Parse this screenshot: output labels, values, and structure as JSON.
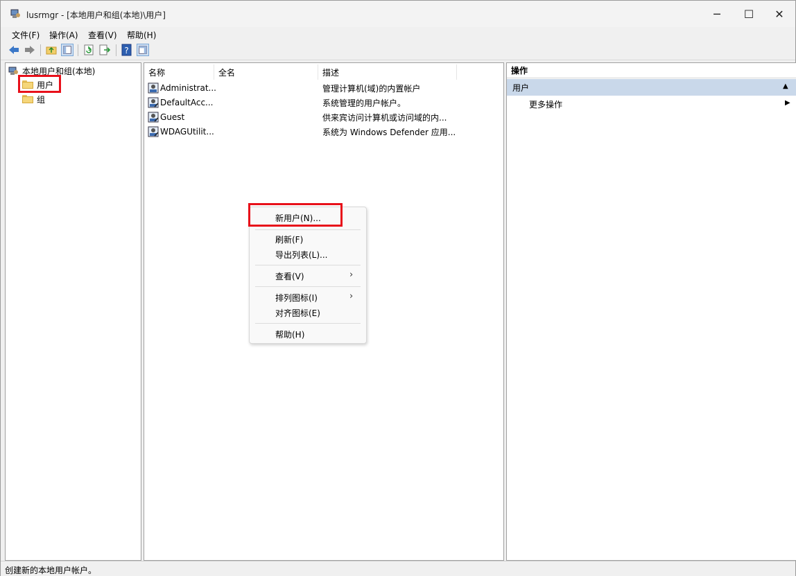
{
  "window": {
    "title": "lusrmgr - [本地用户和组(本地)\\用户]",
    "minimize": "─",
    "maximize": "☐",
    "close": "✕"
  },
  "menubar": [
    "文件(F)",
    "操作(A)",
    "查看(V)",
    "帮助(H)"
  ],
  "tree": {
    "root": "本地用户和组(本地)",
    "items": [
      "用户",
      "组"
    ],
    "selected": "用户"
  },
  "list": {
    "columns": [
      "名称",
      "全名",
      "描述"
    ],
    "rows": [
      {
        "name": "Administrat...",
        "fullname": "",
        "description": "管理计算机(域)的内置帐户"
      },
      {
        "name": "DefaultAcc...",
        "fullname": "",
        "description": "系统管理的用户帐户。"
      },
      {
        "name": "Guest",
        "fullname": "",
        "description": "供来宾访问计算机或访问域的内..."
      },
      {
        "name": "WDAGUtilit...",
        "fullname": "",
        "description": "系统为 Windows Defender 应用..."
      }
    ]
  },
  "actions": {
    "header": "操作",
    "section": "用户",
    "item": "更多操作"
  },
  "context_menu": {
    "items": [
      "新用户(N)...",
      "刷新(F)",
      "导出列表(L)...",
      "查看(V)",
      "排列图标(I)",
      "对齐图标(E)",
      "帮助(H)"
    ],
    "highlighted": "新用户(N)..."
  },
  "status": "创建新的本地用户帐户。",
  "colors": {
    "highlight_box": "#e8101a",
    "action_section_bg": "#c9d8ea"
  }
}
